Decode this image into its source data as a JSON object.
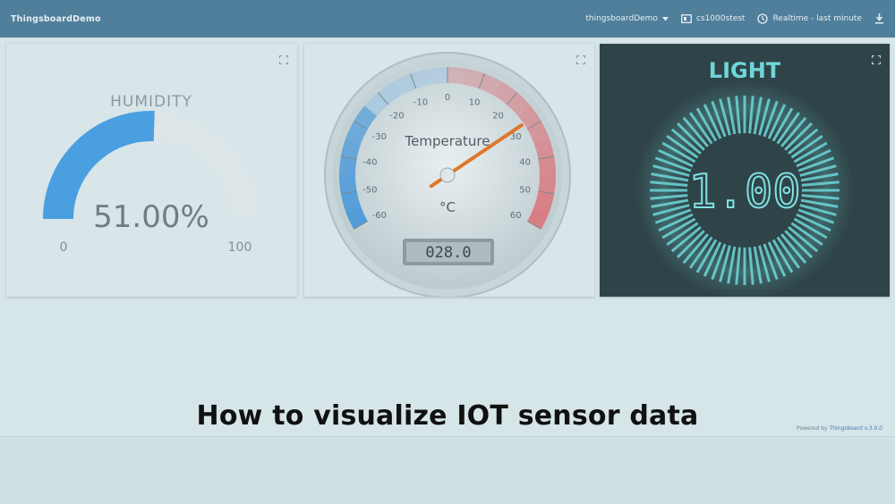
{
  "app": {
    "title": "ThingsboardDemo",
    "user_menu_label": "thingsboardDemo",
    "device_label": "cs1000stest",
    "timewindow_label": "Realtime - last minute"
  },
  "widgets": {
    "humidity": {
      "title": "HUMIDITY",
      "value_text": "51.00%",
      "value": 51.0,
      "min": 0,
      "max": 100,
      "min_label": "0",
      "max_label": "100",
      "fill_color": "#4a9fe0",
      "track_color": "#dce5e8"
    },
    "temperature": {
      "title": "Temperature",
      "unit": "°C",
      "value": 28.0,
      "lcd_text": "028.0",
      "min": -60,
      "max": 60,
      "tick_labels": [
        "-60",
        "-50",
        "-40",
        "-30",
        "-20",
        "-10",
        "0",
        "10",
        "20",
        "30",
        "40",
        "50",
        "60"
      ],
      "cold_color": "#4f9bd9",
      "hot_color": "#d97a80",
      "needle_color": "#e0762b"
    },
    "light": {
      "title": "LIGHT",
      "value_text": "1.00",
      "value": 1.0,
      "accent_color": "#6fd6d8"
    }
  },
  "caption": "How to visualize IOT sensor data",
  "footer": {
    "powered_by": "Powered by",
    "brand": "Thingsboard v.3.0.0"
  },
  "icons": {
    "user_menu": "chevron-down-icon",
    "device": "dashboard-icon",
    "timewindow": "clock-icon",
    "download": "download-icon",
    "expand": "fullscreen-icon"
  }
}
